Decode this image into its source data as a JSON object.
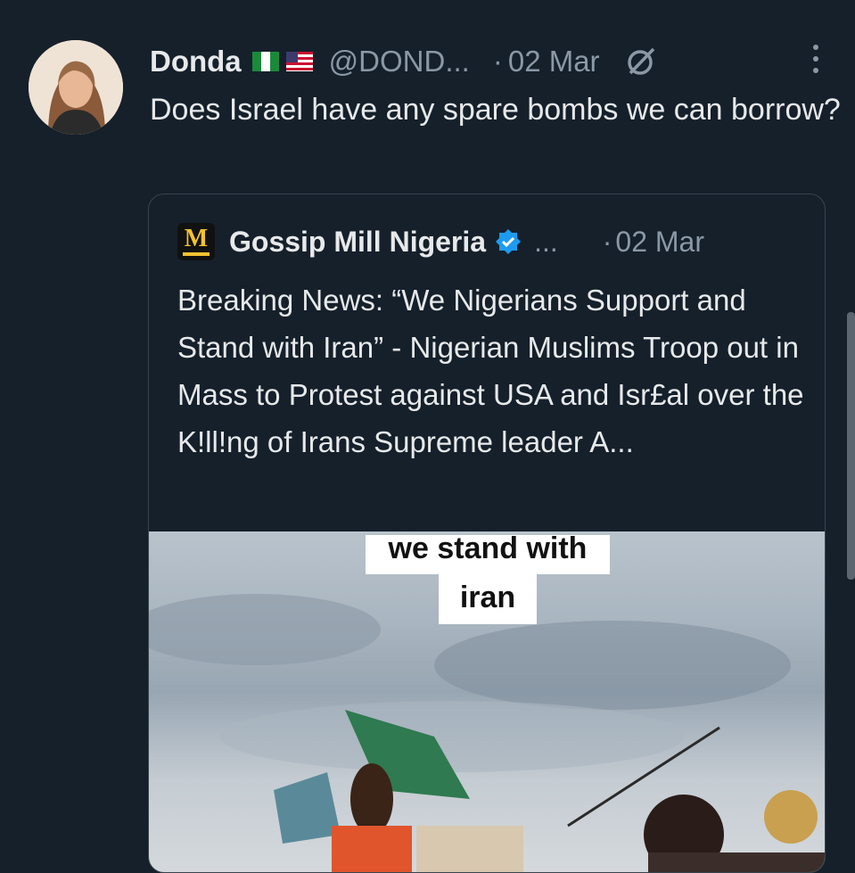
{
  "tweet": {
    "author_name": "Donda",
    "handle": "@DOND...",
    "separator": "·",
    "date": "02 Mar",
    "text": "Does Israel have any spare bombs we can borrow?",
    "flags": [
      "nigeria-flag",
      "usa-flag"
    ]
  },
  "quote": {
    "logo_letter": "M",
    "author_name": "Gossip Mill Nigeria",
    "ellipsis": "...",
    "separator": "·",
    "date": "02 Mar",
    "text": "Breaking News: “We Nigerians Support and Stand with Iran” - Nigerian Muslims Troop out in Mass to Protest against USA and Isr£al over the K!ll!ng of Irans Supreme leader A...",
    "media": {
      "caption_line1": "we stand with",
      "caption_line2": "iran"
    }
  },
  "colors": {
    "background": "#15202b",
    "text": "#e7e9ea",
    "secondary": "#8b98a5",
    "verified": "#1d9bf0",
    "border": "#38444d"
  },
  "icons": [
    "grok-icon",
    "more-icon",
    "verified-icon",
    "nigeria-flag-icon",
    "usa-flag-icon"
  ]
}
